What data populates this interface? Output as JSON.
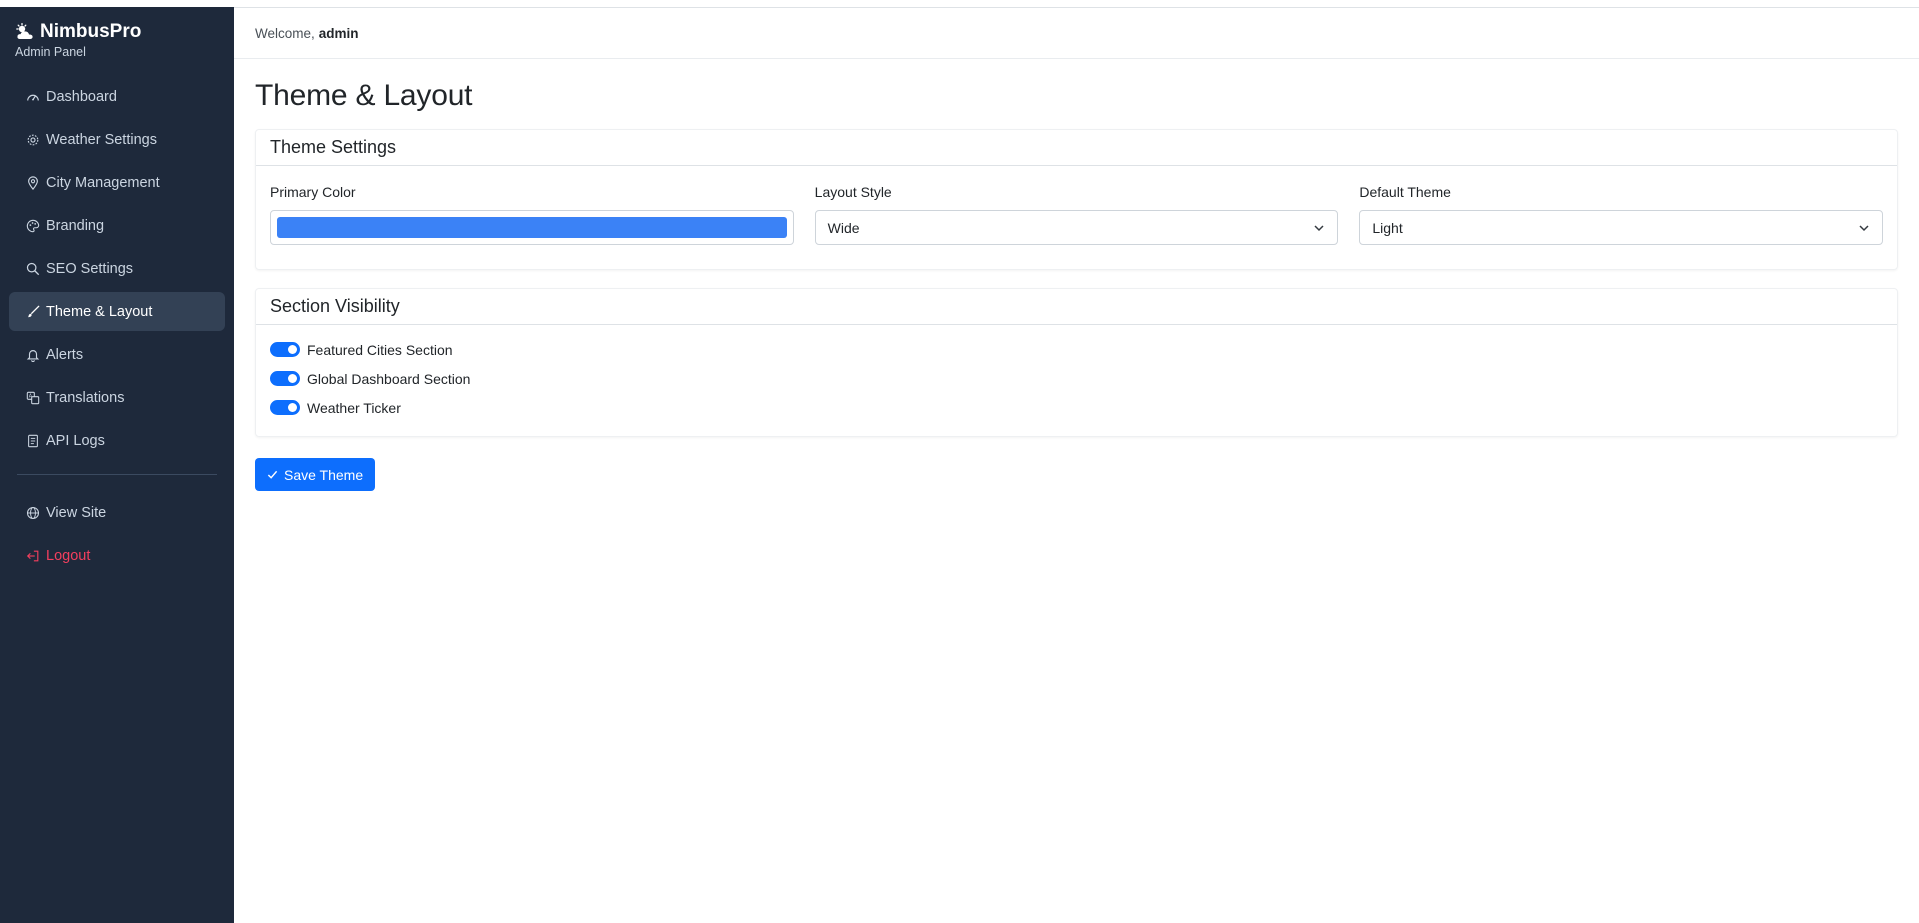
{
  "brand": {
    "name": "NimbusPro",
    "subtitle": "Admin Panel",
    "icon": "cloud-sun-icon"
  },
  "sidebar": {
    "items": [
      {
        "label": "Dashboard",
        "icon": "speedometer-icon"
      },
      {
        "label": "Weather Settings",
        "icon": "gear-icon"
      },
      {
        "label": "City Management",
        "icon": "map-pin-icon"
      },
      {
        "label": "Branding",
        "icon": "palette-icon"
      },
      {
        "label": "SEO Settings",
        "icon": "search-icon"
      },
      {
        "label": "Theme & Layout",
        "icon": "brush-icon",
        "active": true
      },
      {
        "label": "Alerts",
        "icon": "bell-icon"
      },
      {
        "label": "Translations",
        "icon": "translate-icon"
      },
      {
        "label": "API Logs",
        "icon": "document-icon"
      }
    ],
    "footer_items": [
      {
        "label": "View Site",
        "icon": "globe-icon"
      },
      {
        "label": "Logout",
        "icon": "logout-icon"
      }
    ]
  },
  "topbar": {
    "welcome": "Welcome,",
    "user": "admin"
  },
  "page": {
    "title": "Theme & Layout"
  },
  "theme_settings": {
    "header": "Theme Settings",
    "primary_color_label": "Primary Color",
    "primary_color_value": "#3b82f6",
    "layout_style_label": "Layout Style",
    "layout_style_value": "Wide",
    "default_theme_label": "Default Theme",
    "default_theme_value": "Light"
  },
  "section_visibility": {
    "header": "Section Visibility",
    "toggles": [
      {
        "label": "Featured Cities Section",
        "on": true
      },
      {
        "label": "Global Dashboard Section",
        "on": true
      },
      {
        "label": "Weather Ticker",
        "on": true
      }
    ]
  },
  "actions": {
    "save_label": "Save Theme"
  },
  "colors": {
    "sidebar_bg": "#1e293b",
    "accent": "#0d6efd",
    "logout": "#f43f5e"
  }
}
